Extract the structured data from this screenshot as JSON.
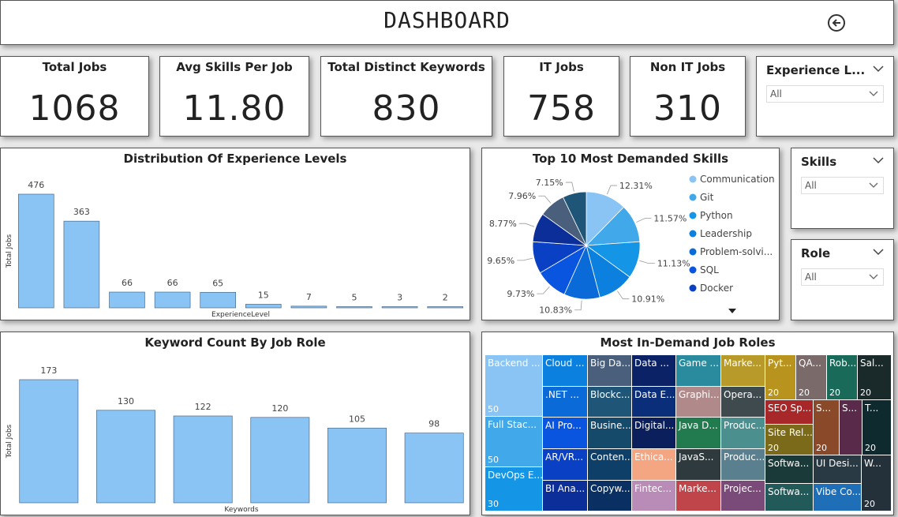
{
  "header": {
    "title": "DASHBOARD",
    "back_icon": "back-arrow-circle-icon"
  },
  "kpis": [
    {
      "label": "Total Jobs",
      "value": "1068"
    },
    {
      "label": "Avg Skills Per Job",
      "value": "11.80"
    },
    {
      "label": "Total Distinct Keywords",
      "value": "830"
    },
    {
      "label": "IT Jobs",
      "value": "758"
    },
    {
      "label": "Non IT Jobs",
      "value": "310"
    }
  ],
  "slicers": {
    "experience": {
      "label": "Experience L...",
      "value": "All"
    },
    "skills": {
      "label": "Skills",
      "value": "All"
    },
    "role": {
      "label": "Role",
      "value": "All"
    }
  },
  "chart_data": [
    {
      "type": "bar",
      "title": "Distribution Of Experience Levels",
      "xlabel": "ExperienceLevel",
      "ylabel": "Total Jobs",
      "values": [
        476,
        363,
        66,
        66,
        65,
        15,
        7,
        5,
        3,
        2
      ],
      "color": "#89c4f4"
    },
    {
      "type": "pie",
      "title": "Top 10 Most Demanded Skills",
      "legend": [
        "Communication",
        "Git",
        "Python",
        "Leadership",
        "Problem-solvi...",
        "SQL",
        "Docker"
      ],
      "slice_labels": [
        "12.31%",
        "11.57%",
        "11.13%",
        "10.91%",
        "10.83%",
        "9.73%",
        "9.65%",
        "8.77%",
        "7.96%",
        "7.15%"
      ],
      "values": [
        12.31,
        11.57,
        11.13,
        10.91,
        10.83,
        9.73,
        9.65,
        8.77,
        7.96,
        7.15
      ],
      "colors": [
        "#89c4f4",
        "#41a8ea",
        "#1495e6",
        "#0b80de",
        "#0a6bd8",
        "#0a55df",
        "#0a41c4",
        "#0b2e99",
        "#4a5f7c",
        "#1f5677"
      ]
    },
    {
      "type": "bar",
      "title": "Keyword Count By Job Role",
      "xlabel": "Keywords",
      "ylabel": "Total Jobs",
      "values": [
        173,
        130,
        122,
        120,
        105,
        98
      ],
      "color": "#89c4f4"
    },
    {
      "type": "treemap",
      "title": "Most In-Demand Job Roles",
      "cells": [
        {
          "label": "Backend ...",
          "value": "50",
          "color": "#89c4f4"
        },
        {
          "label": "Full Stac...",
          "value": "50",
          "color": "#41a8ea"
        },
        {
          "label": "DevOps E...",
          "value": "30",
          "color": "#1495e6"
        },
        {
          "label": "Cloud ...",
          "value": "",
          "color": "#0b80de"
        },
        {
          "label": ".NET ...",
          "value": "",
          "color": "#0a6bd8"
        },
        {
          "label": "AI Pro...",
          "value": "",
          "color": "#0a55df"
        },
        {
          "label": "AR/VR...",
          "value": "",
          "color": "#0a41c4"
        },
        {
          "label": "BI Ana...",
          "value": "",
          "color": "#0b2e99"
        },
        {
          "label": "Big Da...",
          "value": "",
          "color": "#4a5f7c"
        },
        {
          "label": "Blockc...",
          "value": "",
          "color": "#1f5677"
        },
        {
          "label": "Busine...",
          "value": "",
          "color": "#164a6b"
        },
        {
          "label": "Conten...",
          "value": "",
          "color": "#0e3f69"
        },
        {
          "label": "Copyw...",
          "value": "",
          "color": "#0a2f63"
        },
        {
          "label": "Data ...",
          "value": "",
          "color": "#0b2266"
        },
        {
          "label": "Data E...",
          "value": "",
          "color": "#0b2e7a"
        },
        {
          "label": "Digital...",
          "value": "",
          "color": "#0a1f5c"
        },
        {
          "label": "Ethica...",
          "value": "",
          "color": "#f4a582"
        },
        {
          "label": "Fintec...",
          "value": "",
          "color": "#b98bb7"
        },
        {
          "label": "Game ...",
          "value": "",
          "color": "#2a8a9e"
        },
        {
          "label": "Graphi...",
          "value": "",
          "color": "#b08a8a"
        },
        {
          "label": "Java D...",
          "value": "",
          "color": "#227a4f"
        },
        {
          "label": "JavaS...",
          "value": "",
          "color": "#2f3a3f"
        },
        {
          "label": "Marke...",
          "value": "",
          "color": "#c0454a"
        },
        {
          "label": "Marke...",
          "value": "",
          "color": "#b89a2a"
        },
        {
          "label": "Opera...",
          "value": "",
          "color": "#3f4a4f"
        },
        {
          "label": "Produc...",
          "value": "",
          "color": "#4c8f8f"
        },
        {
          "label": "Produc...",
          "value": "",
          "color": "#5a7f8f"
        },
        {
          "label": "Projec...",
          "value": "",
          "color": "#7a4a78"
        },
        {
          "label": "Pyt...",
          "value": "20",
          "color": "#b8941f"
        },
        {
          "label": "QA...",
          "value": "20",
          "color": "#7a6a6a"
        },
        {
          "label": "Rob...",
          "value": "20",
          "color": "#1a6a5a"
        },
        {
          "label": "Sal...",
          "value": "20",
          "color": "#1a2a2a"
        },
        {
          "label": "SEO Sp...",
          "value": "",
          "color": "#a8282a"
        },
        {
          "label": "S...",
          "value": "20",
          "color": "#8a4a2a"
        },
        {
          "label": "S...",
          "value": "",
          "color": "#5a2a4a"
        },
        {
          "label": "T...",
          "value": "20",
          "color": "#0f2a2f"
        },
        {
          "label": "Site Rel...",
          "value": "20",
          "color": "#7a6a1a"
        },
        {
          "label": "Softwa...",
          "value": "",
          "color": "#1a3a3a"
        },
        {
          "label": "Softwa...",
          "value": "",
          "color": "#225a5a"
        },
        {
          "label": "UI Desi...",
          "value": "",
          "color": "#2a3a44"
        },
        {
          "label": "Vibe Co...",
          "value": "",
          "color": "#1f6fb8"
        },
        {
          "label": "W...",
          "value": "20",
          "color": "#24303a"
        }
      ]
    }
  ]
}
